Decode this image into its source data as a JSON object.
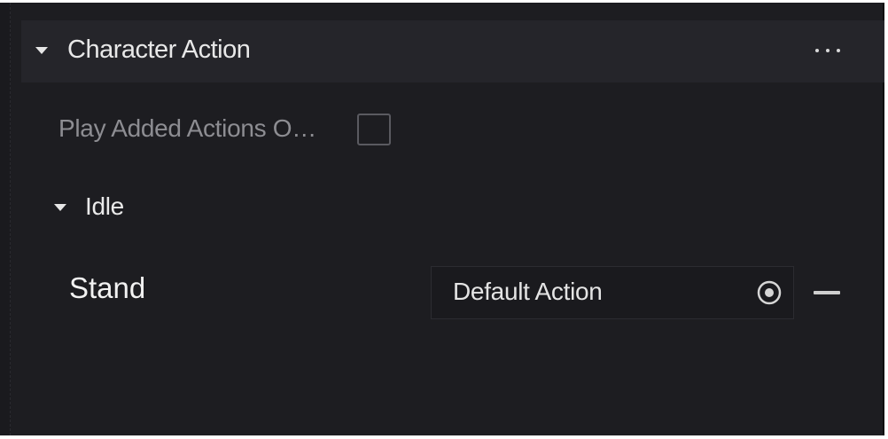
{
  "section": {
    "title": "Character Action",
    "caret_icon": "caret-down-icon",
    "more_icon": "more-horizontal-icon"
  },
  "options": {
    "play_added_actions_label": "Play Added Actions O…",
    "play_added_actions_checked": false
  },
  "group": {
    "title": "Idle",
    "caret_icon": "caret-down-icon"
  },
  "actions": [
    {
      "label": "Stand",
      "value": "Default Action",
      "picker_icon": "target-icon",
      "remove_icon": "minus-icon"
    }
  ],
  "colors": {
    "panel_bg": "#1d1d21",
    "header_bg": "#25252a",
    "text_primary": "#eaeaea",
    "text_muted": "#8d8d92"
  }
}
